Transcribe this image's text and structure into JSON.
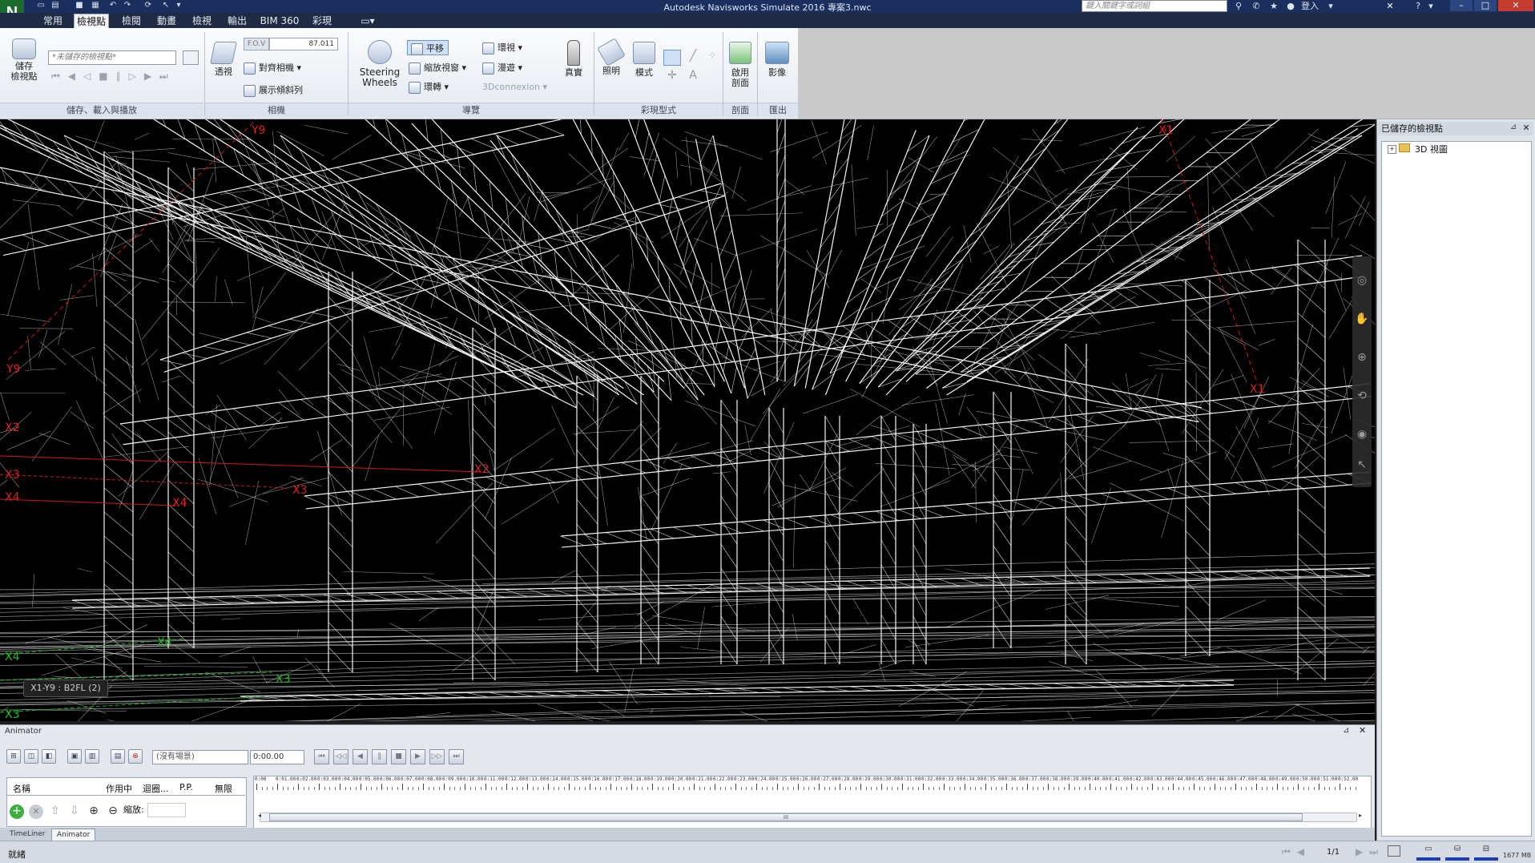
{
  "app": {
    "title": "Autodesk Navisworks Simulate 2016    專案3.nwc",
    "logo": "N",
    "search_placeholder": "鍵入關鍵字或詞組",
    "login": "登入"
  },
  "menu_tabs": [
    "常用",
    "檢視點",
    "檢閱",
    "動畫",
    "檢視",
    "輸出",
    "BIM 360",
    "彩現"
  ],
  "active_tab": "檢視點",
  "ribbon": {
    "save_viewpoint": "儲存\n檢視點",
    "saved_viewpoint_combo": "*未儲存的檢視點*",
    "perspective": "透視",
    "fov_label": "F.O.V",
    "fov_value": "87.011",
    "align_camera": "對齊相機",
    "show_tilt": "展示傾斜列",
    "steering_wheels": "Steering\nWheels",
    "pan": "平移",
    "zoom_window": "縮放視窗",
    "orbit": "環轉",
    "look_around": "環視",
    "walk": "漫遊",
    "connexion": "3Dconnexion",
    "realism": "真實",
    "lighting": "照明",
    "mode": "模式",
    "enable_sectioning": "啟用\n剖面",
    "image": "影像",
    "groups": {
      "save_load_playback": "儲存、載入與播放",
      "camera": "相機",
      "navigate": "導覽",
      "render_style": "彩現型式",
      "sectioning": "剖面",
      "export": "匯出"
    }
  },
  "viewport": {
    "grid_labels": [
      "Y9",
      "X2",
      "X3",
      "X4",
      "X3",
      "X4",
      "X2",
      "X1",
      "X1",
      "Y9",
      "X4",
      "X3",
      "X4",
      "X3"
    ],
    "location_label": "X1-Y9 : B2FL (2)"
  },
  "saved_viewpoints": {
    "title": "已儲存的檢視點",
    "tree_items": [
      {
        "label": "3D 視圖"
      }
    ]
  },
  "animator": {
    "title": "Animator",
    "scene_combo": "(沒有場景)",
    "time_value": "0:00.00",
    "columns": [
      "名稱",
      "作用中",
      "迴圈...",
      "P.P.",
      "無限"
    ],
    "scale_label": "縮放:",
    "timeline_labels": [
      "0:00",
      "0:01.00",
      "0:02.00",
      "0:03.00",
      "0:04.00",
      "0:05.00",
      "0:06.00",
      "0:07.00",
      "0:08.00",
      "0:09.00",
      "0:10.00",
      "0:11.00",
      "0:12.00",
      "0:13.00",
      "0:14.00",
      "0:15.00",
      "0:16.00",
      "0:17.00",
      "0:18.00",
      "0:19.00",
      "0:20.00",
      "0:21.00",
      "0:22.00",
      "0:23.00",
      "0:24.00",
      "0:25.00",
      "0:26.00",
      "0:27.00",
      "0:28.00",
      "0:29.00",
      "0:30.00",
      "0:31.00",
      "0:32.00",
      "0:33.00",
      "0:34.00",
      "0:35.00",
      "0:36.00",
      "0:37.00",
      "0:38.00",
      "0:39.00",
      "0:40.00",
      "0:41.00",
      "0:42.00",
      "0:43.00",
      "0:44.00",
      "0:45.00",
      "0:46.00",
      "0:47.00",
      "0:48.00",
      "0:49.00",
      "0:50.00",
      "0:51.00",
      "0:52.00",
      "0:53.00",
      "0:54.00",
      "0:55.00",
      "0:56.00",
      "0:57.00",
      "0:58.00",
      "0:59.00",
      "1:00.00",
      "1:01.00",
      "1:02.00",
      "1:03.00"
    ],
    "scroll_grip": "III"
  },
  "bottom_tabs": [
    "TimeLiner",
    "Animator"
  ],
  "active_bottom_tab": "Animator",
  "status": {
    "text": "就緒",
    "page": "1/1",
    "memory": "1677 MB"
  },
  "colors": {
    "title_bar": "#1b2f5e",
    "grid_red": "#e02020",
    "grid_green": "#20c020",
    "wire": "#ffffff"
  }
}
